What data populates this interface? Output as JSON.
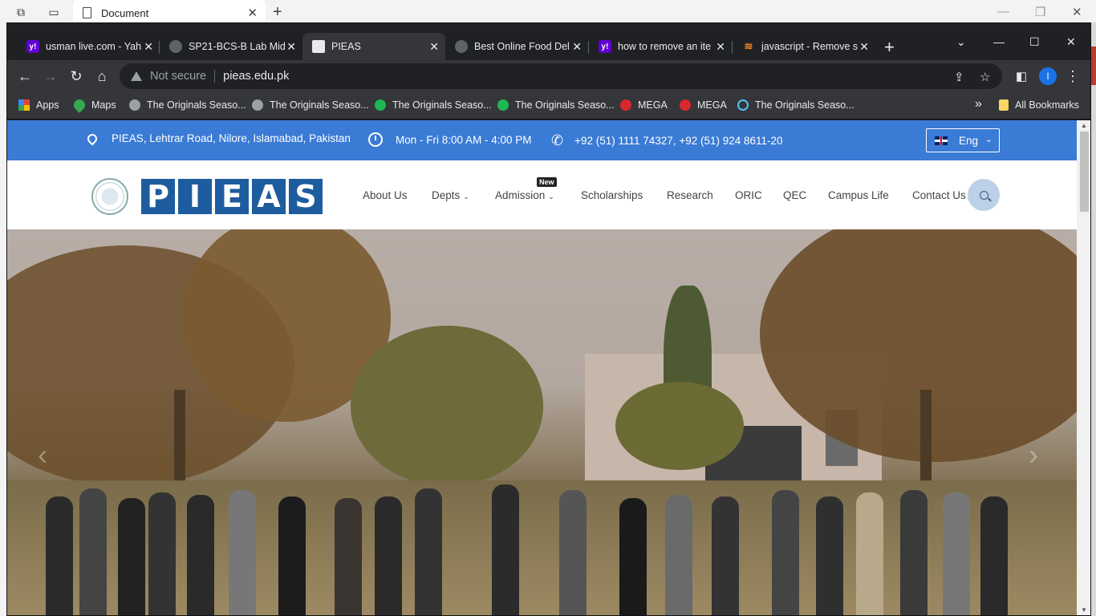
{
  "outer_window": {
    "tab_title": "Document",
    "tab_close": "✕",
    "new_tab": "+",
    "controls": [
      "—",
      "❐",
      "✕"
    ]
  },
  "tabs": [
    {
      "title": "usman live.com - Yah",
      "favicon": "yahoo-icon",
      "fav_text": "y!"
    },
    {
      "title": "SP21-BCS-B Lab Mid",
      "favicon": "globe-icon",
      "fav_text": ""
    },
    {
      "title": "PIEAS",
      "favicon": "pieas-icon",
      "fav_text": "",
      "active": true
    },
    {
      "title": "Best Online Food Del",
      "favicon": "globe-icon",
      "fav_text": ""
    },
    {
      "title": "how to remove an ite",
      "favicon": "yahoo-icon",
      "fav_text": "y!"
    },
    {
      "title": "javascript - Remove s",
      "favicon": "stackoverflow-icon",
      "fav_text": "≋"
    }
  ],
  "chrome_controls": [
    "⌄",
    "—",
    "☐",
    "✕"
  ],
  "toolbar": {
    "security": "Not secure",
    "url": "pieas.edu.pk",
    "profile_initial": "I"
  },
  "bookmarks": [
    {
      "label": "Apps",
      "icon": "apps-icon"
    },
    {
      "label": "Maps",
      "icon": "maps-icon"
    },
    {
      "label": "The Originals Seaso...",
      "icon": "globe-icon"
    },
    {
      "label": "The Originals Seaso...",
      "icon": "globe-icon"
    },
    {
      "label": "The Originals Seaso...",
      "icon": "green-icon"
    },
    {
      "label": "The Originals Seaso...",
      "icon": "green-icon"
    },
    {
      "label": "MEGA",
      "icon": "mega-icon"
    },
    {
      "label": "MEGA",
      "icon": "mega-icon"
    },
    {
      "label": "The Originals Seaso...",
      "icon": "play-icon"
    }
  ],
  "bookmarks_overflow": "»",
  "all_bookmarks": "All Bookmarks",
  "site": {
    "address": "PIEAS, Lehtrar Road, Nilore, Islamabad, Pakistan",
    "hours": "Mon - Fri 8:00 AM - 4:00 PM",
    "phones": "+92 (51) 1111 74327, +92 (51) 924 8611-20",
    "language": "Eng",
    "logo_letters": [
      "P",
      "I",
      "E",
      "A",
      "S"
    ],
    "new_badge": "New",
    "nav": [
      {
        "label": "About Us",
        "dropdown": false
      },
      {
        "label": "Depts",
        "dropdown": true
      },
      {
        "label": "Admission",
        "dropdown": true
      },
      {
        "label": "Scholarships",
        "dropdown": false
      },
      {
        "label": "Research",
        "dropdown": false
      },
      {
        "label": "ORIC",
        "dropdown": false
      },
      {
        "label": "QEC",
        "dropdown": false
      },
      {
        "label": "Campus Life",
        "dropdown": false
      },
      {
        "label": "Contact Us",
        "dropdown": false
      }
    ],
    "hero_prev": "‹",
    "hero_next": "›"
  },
  "colors": {
    "topbar": "#3a7bd5",
    "logo": "#1d5c9e",
    "chrome_dark": "#202124"
  }
}
